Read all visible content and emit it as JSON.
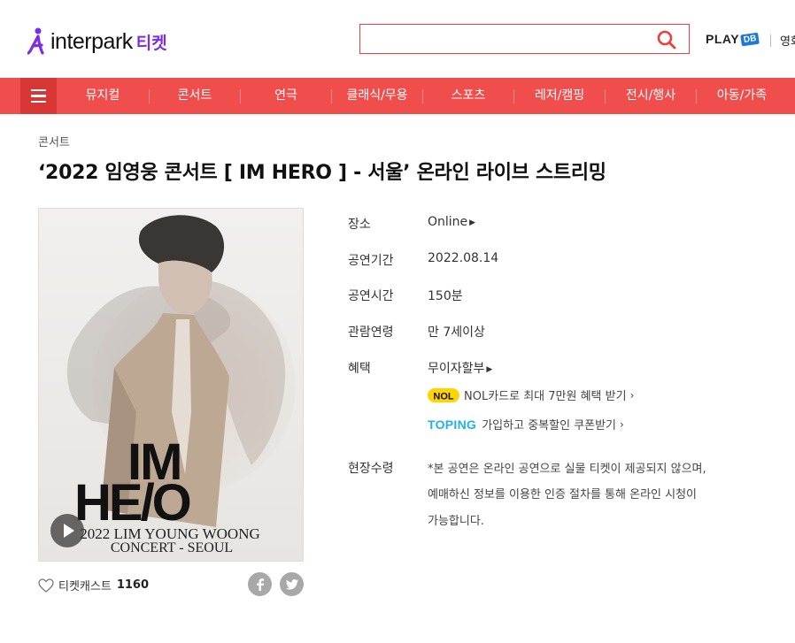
{
  "header": {
    "logo_text": "interpark",
    "logo_sub": "티켓",
    "search": {
      "value": "",
      "placeholder": ""
    },
    "playdb_text": "PLAY",
    "playdb_badge": "DB",
    "link": "영화"
  },
  "nav": {
    "items": [
      {
        "label": "뮤지컬"
      },
      {
        "label": "콘서트"
      },
      {
        "label": "연극"
      },
      {
        "label": "클래식/무용"
      },
      {
        "label": "스포츠"
      },
      {
        "label": "레저/캠핑"
      },
      {
        "label": "전시/행사"
      },
      {
        "label": "아동/가족"
      }
    ]
  },
  "product": {
    "category": "콘서트",
    "title": "‘2022 임영웅 콘서트 [ IM HERO ] - 서울’ 온라인 라이브 스트리밍",
    "poster": {
      "headline_1": "IM",
      "headline_2": "HE/O",
      "subline_1": "2022 LIM YOUNG WOONG",
      "subline_2": "CONCERT - SEOUL"
    },
    "like_label": "티켓캐스트",
    "like_count": "1160",
    "info": {
      "venue_label": "장소",
      "venue_value": "Online",
      "period_label": "공연기간",
      "period_value": "2022.08.14",
      "runtime_label": "공연시간",
      "runtime_value": "150분",
      "age_label": "관람연령",
      "age_value": "만 7세이상",
      "benefit_label": "혜택",
      "benefit_value": "무이자할부",
      "benefit_nol": "NOL카드로 최대 7만원 혜택 받기",
      "benefit_toping_brand": "TOPING",
      "benefit_toping": "가입하고 중복할인 쿠폰받기",
      "onsite_label": "현장수령",
      "onsite_lines": [
        "*본 공연은 온라인 공연으로 실물 티켓이 제공되지 않으며,",
        "예매하신 정보를 이용한 인증 절차를 통해 온라인 시청이",
        "가능합니다."
      ]
    }
  },
  "colors": {
    "nav_bg": "#ef4e4c",
    "nav_menu_bg": "#d93636",
    "brand_purple": "#7b2ee6",
    "search_border": "#ef3e42"
  },
  "icons": [
    "logo-mark-icon",
    "search-icon",
    "menu-icon",
    "play-icon",
    "heart-icon",
    "facebook-icon",
    "twitter-icon",
    "nol-icon",
    "caret-right-icon",
    "chevron-right-icon"
  ]
}
